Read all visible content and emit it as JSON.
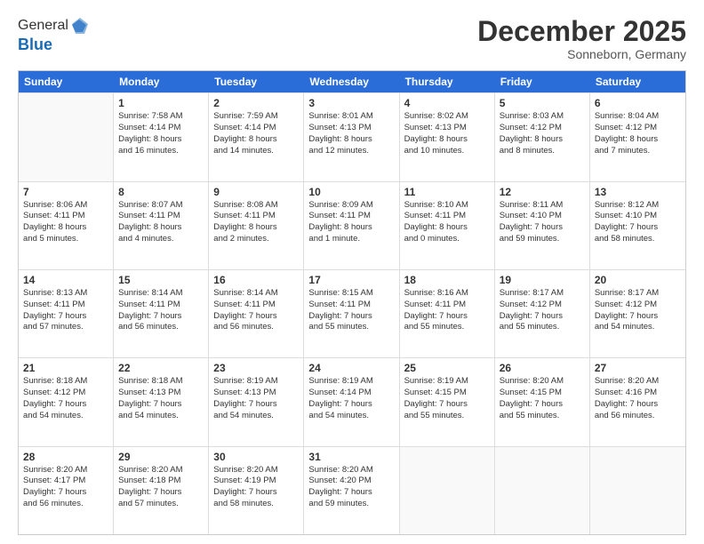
{
  "logo": {
    "general": "General",
    "blue": "Blue"
  },
  "title": "December 2025",
  "location": "Sonneborn, Germany",
  "header_days": [
    "Sunday",
    "Monday",
    "Tuesday",
    "Wednesday",
    "Thursday",
    "Friday",
    "Saturday"
  ],
  "weeks": [
    [
      {
        "day": "",
        "sunrise": "",
        "sunset": "",
        "daylight": "",
        "empty": true
      },
      {
        "day": "1",
        "sunrise": "Sunrise: 7:58 AM",
        "sunset": "Sunset: 4:14 PM",
        "daylight": "Daylight: 8 hours",
        "daylight2": "and 16 minutes."
      },
      {
        "day": "2",
        "sunrise": "Sunrise: 7:59 AM",
        "sunset": "Sunset: 4:14 PM",
        "daylight": "Daylight: 8 hours",
        "daylight2": "and 14 minutes."
      },
      {
        "day": "3",
        "sunrise": "Sunrise: 8:01 AM",
        "sunset": "Sunset: 4:13 PM",
        "daylight": "Daylight: 8 hours",
        "daylight2": "and 12 minutes."
      },
      {
        "day": "4",
        "sunrise": "Sunrise: 8:02 AM",
        "sunset": "Sunset: 4:13 PM",
        "daylight": "Daylight: 8 hours",
        "daylight2": "and 10 minutes."
      },
      {
        "day": "5",
        "sunrise": "Sunrise: 8:03 AM",
        "sunset": "Sunset: 4:12 PM",
        "daylight": "Daylight: 8 hours",
        "daylight2": "and 8 minutes."
      },
      {
        "day": "6",
        "sunrise": "Sunrise: 8:04 AM",
        "sunset": "Sunset: 4:12 PM",
        "daylight": "Daylight: 8 hours",
        "daylight2": "and 7 minutes."
      }
    ],
    [
      {
        "day": "7",
        "sunrise": "Sunrise: 8:06 AM",
        "sunset": "Sunset: 4:11 PM",
        "daylight": "Daylight: 8 hours",
        "daylight2": "and 5 minutes."
      },
      {
        "day": "8",
        "sunrise": "Sunrise: 8:07 AM",
        "sunset": "Sunset: 4:11 PM",
        "daylight": "Daylight: 8 hours",
        "daylight2": "and 4 minutes."
      },
      {
        "day": "9",
        "sunrise": "Sunrise: 8:08 AM",
        "sunset": "Sunset: 4:11 PM",
        "daylight": "Daylight: 8 hours",
        "daylight2": "and 2 minutes."
      },
      {
        "day": "10",
        "sunrise": "Sunrise: 8:09 AM",
        "sunset": "Sunset: 4:11 PM",
        "daylight": "Daylight: 8 hours",
        "daylight2": "and 1 minute."
      },
      {
        "day": "11",
        "sunrise": "Sunrise: 8:10 AM",
        "sunset": "Sunset: 4:11 PM",
        "daylight": "Daylight: 8 hours",
        "daylight2": "and 0 minutes."
      },
      {
        "day": "12",
        "sunrise": "Sunrise: 8:11 AM",
        "sunset": "Sunset: 4:10 PM",
        "daylight": "Daylight: 7 hours",
        "daylight2": "and 59 minutes."
      },
      {
        "day": "13",
        "sunrise": "Sunrise: 8:12 AM",
        "sunset": "Sunset: 4:10 PM",
        "daylight": "Daylight: 7 hours",
        "daylight2": "and 58 minutes."
      }
    ],
    [
      {
        "day": "14",
        "sunrise": "Sunrise: 8:13 AM",
        "sunset": "Sunset: 4:11 PM",
        "daylight": "Daylight: 7 hours",
        "daylight2": "and 57 minutes."
      },
      {
        "day": "15",
        "sunrise": "Sunrise: 8:14 AM",
        "sunset": "Sunset: 4:11 PM",
        "daylight": "Daylight: 7 hours",
        "daylight2": "and 56 minutes."
      },
      {
        "day": "16",
        "sunrise": "Sunrise: 8:14 AM",
        "sunset": "Sunset: 4:11 PM",
        "daylight": "Daylight: 7 hours",
        "daylight2": "and 56 minutes."
      },
      {
        "day": "17",
        "sunrise": "Sunrise: 8:15 AM",
        "sunset": "Sunset: 4:11 PM",
        "daylight": "Daylight: 7 hours",
        "daylight2": "and 55 minutes."
      },
      {
        "day": "18",
        "sunrise": "Sunrise: 8:16 AM",
        "sunset": "Sunset: 4:11 PM",
        "daylight": "Daylight: 7 hours",
        "daylight2": "and 55 minutes."
      },
      {
        "day": "19",
        "sunrise": "Sunrise: 8:17 AM",
        "sunset": "Sunset: 4:12 PM",
        "daylight": "Daylight: 7 hours",
        "daylight2": "and 55 minutes."
      },
      {
        "day": "20",
        "sunrise": "Sunrise: 8:17 AM",
        "sunset": "Sunset: 4:12 PM",
        "daylight": "Daylight: 7 hours",
        "daylight2": "and 54 minutes."
      }
    ],
    [
      {
        "day": "21",
        "sunrise": "Sunrise: 8:18 AM",
        "sunset": "Sunset: 4:12 PM",
        "daylight": "Daylight: 7 hours",
        "daylight2": "and 54 minutes."
      },
      {
        "day": "22",
        "sunrise": "Sunrise: 8:18 AM",
        "sunset": "Sunset: 4:13 PM",
        "daylight": "Daylight: 7 hours",
        "daylight2": "and 54 minutes."
      },
      {
        "day": "23",
        "sunrise": "Sunrise: 8:19 AM",
        "sunset": "Sunset: 4:13 PM",
        "daylight": "Daylight: 7 hours",
        "daylight2": "and 54 minutes."
      },
      {
        "day": "24",
        "sunrise": "Sunrise: 8:19 AM",
        "sunset": "Sunset: 4:14 PM",
        "daylight": "Daylight: 7 hours",
        "daylight2": "and 54 minutes."
      },
      {
        "day": "25",
        "sunrise": "Sunrise: 8:19 AM",
        "sunset": "Sunset: 4:15 PM",
        "daylight": "Daylight: 7 hours",
        "daylight2": "and 55 minutes."
      },
      {
        "day": "26",
        "sunrise": "Sunrise: 8:20 AM",
        "sunset": "Sunset: 4:15 PM",
        "daylight": "Daylight: 7 hours",
        "daylight2": "and 55 minutes."
      },
      {
        "day": "27",
        "sunrise": "Sunrise: 8:20 AM",
        "sunset": "Sunset: 4:16 PM",
        "daylight": "Daylight: 7 hours",
        "daylight2": "and 56 minutes."
      }
    ],
    [
      {
        "day": "28",
        "sunrise": "Sunrise: 8:20 AM",
        "sunset": "Sunset: 4:17 PM",
        "daylight": "Daylight: 7 hours",
        "daylight2": "and 56 minutes."
      },
      {
        "day": "29",
        "sunrise": "Sunrise: 8:20 AM",
        "sunset": "Sunset: 4:18 PM",
        "daylight": "Daylight: 7 hours",
        "daylight2": "and 57 minutes."
      },
      {
        "day": "30",
        "sunrise": "Sunrise: 8:20 AM",
        "sunset": "Sunset: 4:19 PM",
        "daylight": "Daylight: 7 hours",
        "daylight2": "and 58 minutes."
      },
      {
        "day": "31",
        "sunrise": "Sunrise: 8:20 AM",
        "sunset": "Sunset: 4:20 PM",
        "daylight": "Daylight: 7 hours",
        "daylight2": "and 59 minutes."
      },
      {
        "day": "",
        "sunrise": "",
        "sunset": "",
        "daylight": "",
        "daylight2": "",
        "empty": true
      },
      {
        "day": "",
        "sunrise": "",
        "sunset": "",
        "daylight": "",
        "daylight2": "",
        "empty": true
      },
      {
        "day": "",
        "sunrise": "",
        "sunset": "",
        "daylight": "",
        "daylight2": "",
        "empty": true
      }
    ]
  ]
}
